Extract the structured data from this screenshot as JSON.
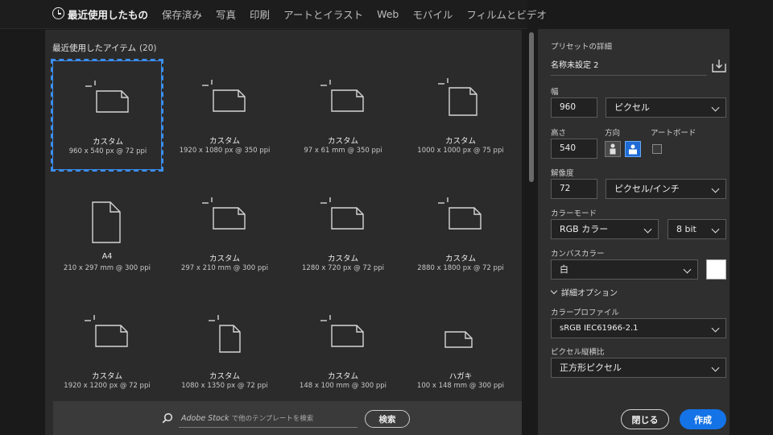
{
  "tabs": [
    {
      "label": "最近使用したもの",
      "active": true
    },
    {
      "label": "保存済み"
    },
    {
      "label": "写真"
    },
    {
      "label": "印刷"
    },
    {
      "label": "アートとイラスト"
    },
    {
      "label": "Web"
    },
    {
      "label": "モバイル"
    },
    {
      "label": "フィルムとビデオ"
    }
  ],
  "recent": {
    "title": "最近使用したアイテム",
    "count": "(20)",
    "items": [
      {
        "name": "カスタム",
        "dims": "960 x 540 px @ 72 ppi",
        "icon": "custom-landscape-icon",
        "selected": true
      },
      {
        "name": "カスタム",
        "dims": "1920 x 1080 px @ 350 ppi",
        "icon": "custom-landscape-icon"
      },
      {
        "name": "カスタム",
        "dims": "97 x 61 mm @ 350 ppi",
        "icon": "custom-landscape-icon"
      },
      {
        "name": "カスタム",
        "dims": "1000 x 1000 px @ 75 ppi",
        "icon": "custom-square-icon"
      },
      {
        "name": "A4",
        "dims": "210 x 297 mm @ 300 ppi",
        "icon": "document-portrait-icon"
      },
      {
        "name": "カスタム",
        "dims": "297 x 210 mm @ 300 ppi",
        "icon": "custom-landscape-icon"
      },
      {
        "name": "カスタム",
        "dims": "1280 x 720 px @ 72 ppi",
        "icon": "custom-landscape-icon"
      },
      {
        "name": "カスタム",
        "dims": "2880 x 1800 px @ 72 ppi",
        "icon": "custom-landscape-icon"
      },
      {
        "name": "カスタム",
        "dims": "1920 x 1200 px @ 72 ppi",
        "icon": "custom-landscape-icon"
      },
      {
        "name": "カスタム",
        "dims": "1080 x 1350 px @ 72 ppi",
        "icon": "custom-portrait-icon"
      },
      {
        "name": "カスタム",
        "dims": "148 x 100 mm @ 300 ppi",
        "icon": "custom-landscape-icon"
      },
      {
        "name": "ハガキ",
        "dims": "100 x 148 mm @ 300 ppi",
        "icon": "postcard-icon"
      }
    ]
  },
  "search": {
    "placeholder_brand": "Adobe Stock",
    "placeholder": "で他のテンプレートを検索",
    "button": "検索"
  },
  "preset": {
    "title": "プリセットの詳細",
    "name": "名称未設定 2",
    "width_label": "幅",
    "width": "960",
    "width_unit": "ピクセル",
    "height_label": "高さ",
    "height": "540",
    "orientation_label": "方向",
    "artboard_label": "アートボード",
    "resolution_label": "解像度",
    "resolution": "72",
    "resolution_unit": "ピクセル/インチ",
    "color_mode_label": "カラーモード",
    "color_mode": "RGB カラー",
    "bit_depth": "8 bit",
    "canvas_color_label": "カンバスカラー",
    "canvas_color": "白",
    "canvas_swatch": "#ffffff",
    "advanced_label": "詳細オプション",
    "profile_label": "カラープロファイル",
    "profile": "sRGB IEC61966-2.1",
    "pixel_aspect_label": "ピクセル縦横比",
    "pixel_aspect": "正方形ピクセル",
    "close_button": "閉じる",
    "create_button": "作成"
  },
  "colors": {
    "accent": "#1473e6",
    "selection": "#3b8ef0"
  }
}
